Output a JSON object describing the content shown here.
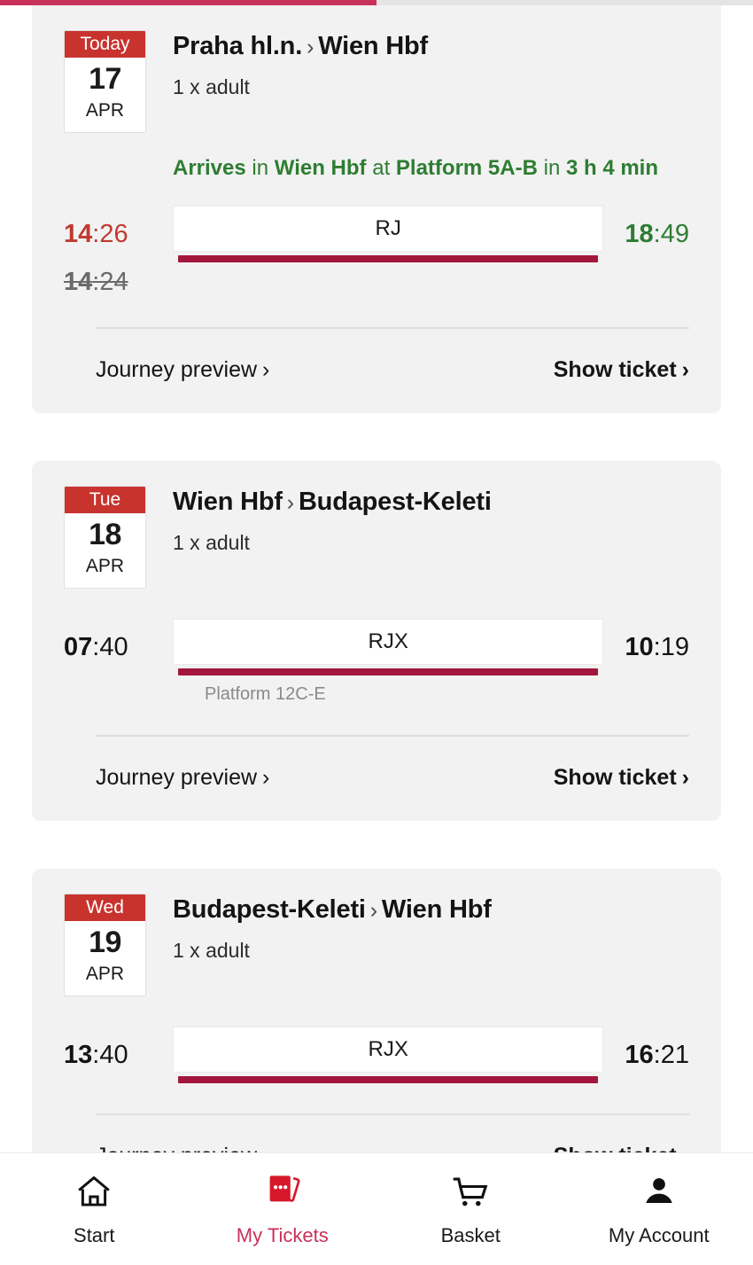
{
  "theme": {
    "brand_red": "#c8332e",
    "accent_pink": "#c8315a",
    "rule_crimson": "#a4173c",
    "success_green": "#2e7d32",
    "delay_red": "#bf3a30",
    "card_bg": "#f2f2f2",
    "page_bg": "#ffffff"
  },
  "progress": {
    "percent": 50
  },
  "tickets": [
    {
      "calendar": {
        "weekday": "Today",
        "day": "17",
        "month": "APR"
      },
      "origin": "Praha hl.n.",
      "separator": "›",
      "destination": "Wien Hbf",
      "passengers": "1 x adult",
      "status": {
        "prefix": "Arrives",
        "in_word": "in",
        "station": "Wien Hbf",
        "at_word": "at",
        "platform": "Platform 5A-B",
        "suffix_word": "in",
        "duration": "3 h 4 min"
      },
      "departure": {
        "hh": "14",
        "mm": ":26",
        "state": "delayed"
      },
      "departure_original": {
        "hh": "14",
        "mm": ":24"
      },
      "arrival": {
        "hh": "18",
        "mm": ":49",
        "state": "ok"
      },
      "train": "RJ",
      "platform_note": "",
      "actions": {
        "preview": "Journey preview",
        "ticket": "Show ticket",
        "chevron": "›"
      }
    },
    {
      "calendar": {
        "weekday": "Tue",
        "day": "18",
        "month": "APR"
      },
      "origin": "Wien Hbf",
      "separator": "›",
      "destination": "Budapest-Keleti",
      "passengers": "1 x adult",
      "status": null,
      "departure": {
        "hh": "07",
        "mm": ":40",
        "state": "normal"
      },
      "departure_original": null,
      "arrival": {
        "hh": "10",
        "mm": ":19",
        "state": "normal"
      },
      "train": "RJX",
      "platform_note": "Platform 12C-E",
      "actions": {
        "preview": "Journey preview",
        "ticket": "Show ticket",
        "chevron": "›"
      }
    },
    {
      "calendar": {
        "weekday": "Wed",
        "day": "19",
        "month": "APR"
      },
      "origin": "Budapest-Keleti",
      "separator": "›",
      "destination": "Wien Hbf",
      "passengers": "1 x adult",
      "status": null,
      "departure": {
        "hh": "13",
        "mm": ":40",
        "state": "normal"
      },
      "departure_original": null,
      "arrival": {
        "hh": "16",
        "mm": ":21",
        "state": "normal"
      },
      "train": "RJX",
      "platform_note": "",
      "actions": {
        "preview": "Journey preview",
        "ticket": "Show ticket",
        "chevron": "›"
      }
    }
  ],
  "bottom_nav": {
    "items": [
      {
        "label": "Start",
        "icon": "home-icon",
        "active": false
      },
      {
        "label": "My Tickets",
        "icon": "tickets-icon",
        "active": true
      },
      {
        "label": "Basket",
        "icon": "shopping-cart-icon",
        "active": false
      },
      {
        "label": "My Account",
        "icon": "person-icon",
        "active": false
      }
    ]
  }
}
